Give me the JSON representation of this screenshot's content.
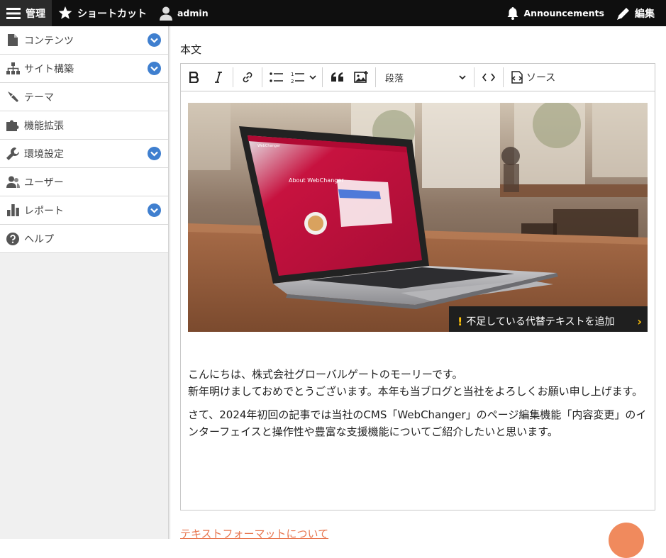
{
  "topbar": {
    "manage_label": "管理",
    "shortcuts_label": "ショートカット",
    "user_label": "admin",
    "announcements_label": "Announcements",
    "edit_label": "編集"
  },
  "sidebar": {
    "items": [
      {
        "label": "コンテンツ",
        "icon": "document-icon",
        "expandable": true
      },
      {
        "label": "サイト構築",
        "icon": "sitemap-icon",
        "expandable": true
      },
      {
        "label": "テーマ",
        "icon": "paintbrush-icon",
        "expandable": false
      },
      {
        "label": "機能拡張",
        "icon": "puzzle-icon",
        "expandable": false
      },
      {
        "label": "環境設定",
        "icon": "wrench-icon",
        "expandable": true
      },
      {
        "label": "ユーザー",
        "icon": "people-icon",
        "expandable": false
      },
      {
        "label": "レポート",
        "icon": "bar-chart-icon",
        "expandable": true
      },
      {
        "label": "ヘルプ",
        "icon": "help-icon",
        "expandable": false
      }
    ]
  },
  "field": {
    "label": "本文"
  },
  "editor": {
    "paragraph_format": "段落",
    "source_label": "ソース",
    "alt_text_warning": "不足している代替テキストを追加",
    "paragraphs": [
      {
        "line1": "こんにちは、株式会社グローバルゲートのモーリーです。",
        "line2": "新年明けましておめでとうございます。本年も当ブログと当社をよろしくお願い申し上げます。"
      },
      {
        "text": "さて、2024年初回の記事では当社のCMS「WebChanger」のページ編集機能「内容変更」のインターフェイスと操作性や豊富な支援機能についてご紹介したいと思います。"
      }
    ]
  },
  "screen_text": {
    "brand": "WebChanger",
    "about": "About WebChanger"
  },
  "format_link": "テキストフォーマットについて",
  "colors": {
    "accent_blue": "#3f7fcf",
    "link_orange": "#e8764f",
    "warning_yellow": "#ffc107",
    "topbar_bg": "#0f0f0f"
  }
}
